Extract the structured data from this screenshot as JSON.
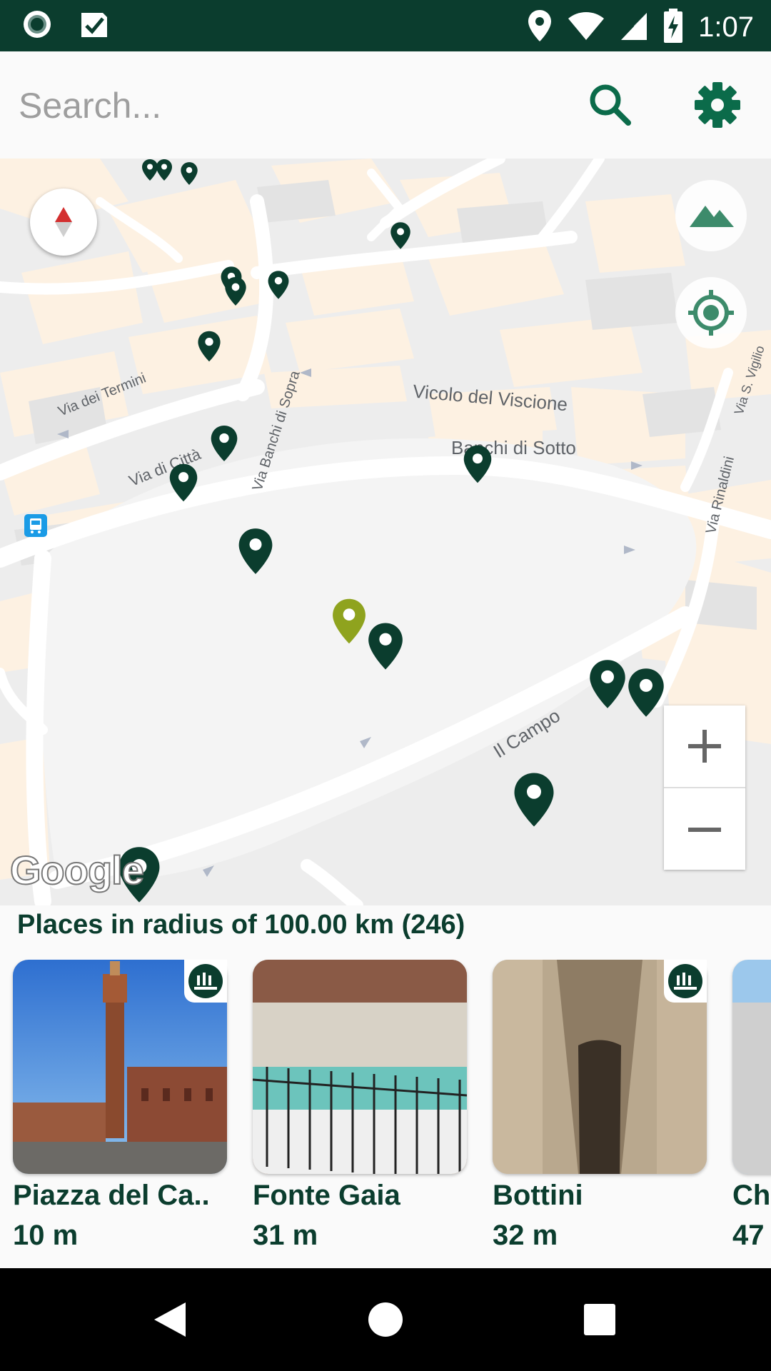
{
  "status_bar": {
    "time": "1:07",
    "icons": [
      "record-icon",
      "check-task-icon",
      "location-icon",
      "wifi-icon",
      "signal-icon",
      "battery-charging-icon"
    ]
  },
  "search": {
    "placeholder": "Search...",
    "search_icon": "search-icon",
    "settings_icon": "gear-icon"
  },
  "map": {
    "street_labels": [
      "Vicolo del Viscione",
      "Banchi di Sotto",
      "Via dei Termini",
      "Via Banchi di Sopra",
      "Via di Città",
      "Il Campo",
      "Via Rinaldini",
      "Via S. Vigilio"
    ],
    "controls": {
      "compass_icon": "compass-icon",
      "terrain_icon": "terrain-icon",
      "my_location_icon": "my-location-icon",
      "zoom_in_label": "+",
      "zoom_out_label": "−"
    },
    "attribution": "Google",
    "colors": {
      "pin": "#0b3d2e",
      "pin_selected": "#8fa31e"
    }
  },
  "places": {
    "header": "Places in radius of 100.00 km (246)",
    "items": [
      {
        "name": "Piazza del Ca..",
        "distance": "10 m",
        "badge": true
      },
      {
        "name": "Fonte Gaia",
        "distance": "31 m",
        "badge": false
      },
      {
        "name": "Bottini",
        "distance": "32 m",
        "badge": true
      },
      {
        "name": "Cha",
        "distance": "47",
        "badge": false
      }
    ]
  },
  "nav_bar": {
    "icons": [
      "back-icon",
      "home-icon",
      "recents-icon"
    ]
  }
}
